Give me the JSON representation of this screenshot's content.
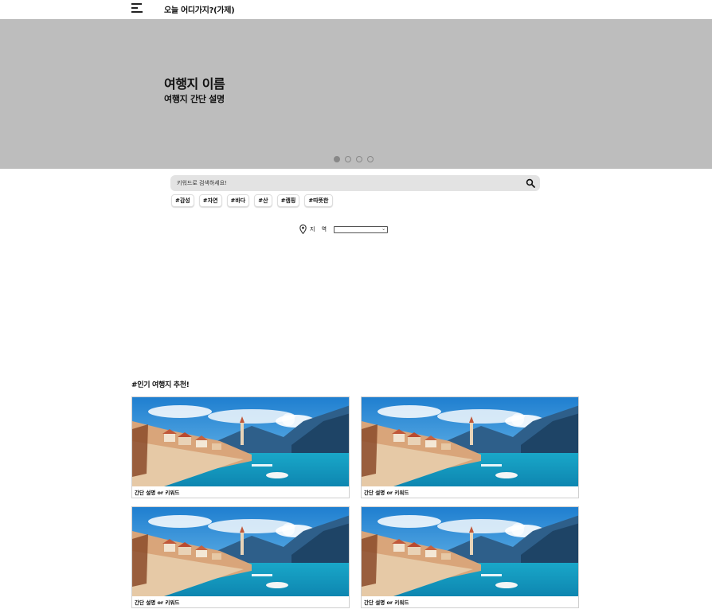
{
  "header": {
    "site_title": "오늘 어디가지?(가제)",
    "menu_icon": "hamburger-menu-icon"
  },
  "hero": {
    "title": "여행지 이름",
    "description": "여행지 간단 설명",
    "slide_count": 4,
    "active_slide": 1
  },
  "search": {
    "placeholder": "키워드로 검색하세요!",
    "value": "",
    "icon": "search-icon"
  },
  "tags": [
    "#감성",
    "#자연",
    "#바다",
    "#산",
    "#캠핑",
    "#따뜻한"
  ],
  "region": {
    "label": "지 역",
    "selected": "",
    "icon": "map-pin-icon"
  },
  "popular": {
    "title": "#인기 여행지 추천!",
    "cards": [
      {
        "caption": "간단 설명 or 키워드"
      },
      {
        "caption": "간단 설명 or 키워드"
      },
      {
        "caption": "간단 설명 or 키워드"
      },
      {
        "caption": "간단 설명 or 키워드"
      }
    ]
  },
  "colors": {
    "hero_bg": "#bdbdbd",
    "search_bg": "#e3e3e3",
    "sea": "#1aa6c8",
    "sky": "#2f8fd6"
  }
}
